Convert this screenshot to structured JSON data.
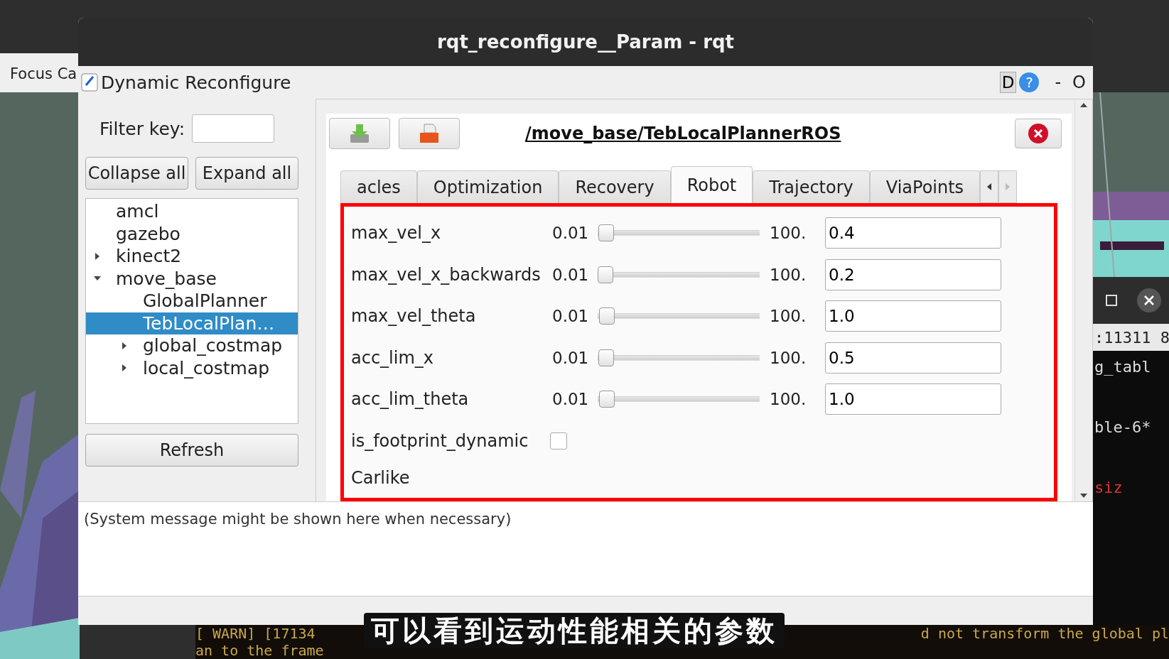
{
  "desktop": {
    "left_window_title": "Focus Ca",
    "terminal_lines": [
      ":11311 8",
      "g_tabl",
      "ble-6*",
      "siz"
    ],
    "bottom_terminal": [
      {
        "left": "[ WARN] [17134",
        "right": "d not transform the global pl"
      },
      {
        "left": "an to the frame"
      }
    ]
  },
  "window": {
    "title": "rqt_reconfigure__Param - rqt"
  },
  "plugin": {
    "title": "Dynamic Reconfigure",
    "d_button": "D",
    "help": "?",
    "minimize": "-",
    "float": "O"
  },
  "filter": {
    "label": "Filter key:"
  },
  "tree_buttons": [
    "Collapse all",
    "Expand all"
  ],
  "tree": [
    {
      "label": "amcl",
      "selected": false
    },
    {
      "label": "gazebo",
      "selected": false
    },
    {
      "label": "kinect2",
      "expanded": false,
      "selected": false
    },
    {
      "label": "move_base",
      "expanded": true,
      "selected": false,
      "children": [
        {
          "label": "GlobalPlanner",
          "selected": false
        },
        {
          "label": "TebLocalPlan…",
          "selected": true
        },
        {
          "label": "global_costmap",
          "expanded": false,
          "selected": false
        },
        {
          "label": "local_costmap",
          "expanded": false,
          "selected": false
        }
      ]
    }
  ],
  "refresh": "Refresh",
  "node": {
    "path": "/move_base/TebLocalPlannerROS"
  },
  "tabs": [
    {
      "label": "acles",
      "selected": false
    },
    {
      "label": "Optimization",
      "selected": false
    },
    {
      "label": "Recovery",
      "selected": false
    },
    {
      "label": "Robot",
      "selected": true
    },
    {
      "label": "Trajectory",
      "selected": false
    },
    {
      "label": "ViaPoints",
      "selected": false
    }
  ],
  "params": [
    {
      "kind": "slider",
      "name": "max_vel_x",
      "min": "0.01",
      "max": "100.",
      "level": 0.004,
      "value": "0.4"
    },
    {
      "kind": "slider",
      "name": "max_vel_x_backwards",
      "min": "0.01",
      "max": "100.",
      "level": 0.002,
      "value": "0.2"
    },
    {
      "kind": "slider",
      "name": "max_vel_theta",
      "min": "0.01",
      "max": "100.",
      "level": 0.01,
      "value": "1.0"
    },
    {
      "kind": "slider",
      "name": "acc_lim_x",
      "min": "0.01",
      "max": "100.",
      "level": 0.005,
      "value": "0.5"
    },
    {
      "kind": "slider",
      "name": "acc_lim_theta",
      "min": "0.01",
      "max": "100.",
      "level": 0.01,
      "value": "1.0"
    },
    {
      "kind": "checkbox",
      "name": "is_footprint_dynamic",
      "checked": false
    },
    {
      "kind": "group",
      "name": "Carlike"
    }
  ],
  "message": "(System message might be shown here when necessary)",
  "subtitle": "可以看到运动性能相关的参数"
}
